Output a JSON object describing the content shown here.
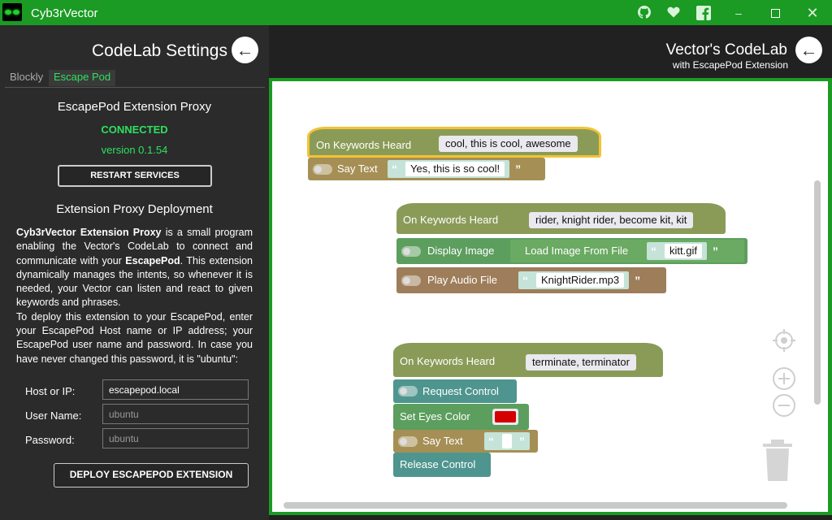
{
  "window": {
    "title": "Cyb3rVector",
    "icons": [
      "github-icon",
      "heart-icon",
      "facebook-icon",
      "minimize-icon",
      "maximize-icon",
      "close-icon"
    ]
  },
  "settings": {
    "title": "CodeLab Settings",
    "tabs": [
      {
        "label": "Blockly",
        "active": false
      },
      {
        "label": "Escape Pod",
        "active": true
      }
    ],
    "proxy_title": "EscapePod Extension Proxy",
    "status": "CONNECTED",
    "version": "version 0.1.54",
    "restart_label": "RESTART SERVICES",
    "deploy_title": "Extension Proxy Deployment",
    "description": {
      "p1_bold": "Cyb3rVector Extension Proxy",
      "p1_a": " is a small program enabling the Vector's CodeLab to connect and communicate with your ",
      "p1_bold2": "EscapePod",
      "p1_b": ". This extension dynamically manages the intents, so whenever it is needed, your Vector can listen and react to given keywords and phrases.",
      "p2": "To deploy this extension to your EscapePod, enter your EscapePod Host name or IP address; your EscapePod user name and password. In case you have never changed this password, it is \"ubuntu\":"
    },
    "form": {
      "host_label": "Host or IP:",
      "host_value": "escapepod.local",
      "user_label": "User Name:",
      "user_placeholder": "ubuntu",
      "pass_label": "Password:",
      "pass_placeholder": "ubuntu"
    },
    "deploy_label": "DEPLOY ESCAPEPOD EXTENSION"
  },
  "codelab": {
    "title": "Vector's CodeLab",
    "subtitle": "with EscapePod Extension",
    "blocks": {
      "g1": {
        "hat": "On Keywords Heard",
        "keywords": "cool, this is cool, awesome",
        "say_label": "Say Text",
        "say_text": "Yes, this is so cool!"
      },
      "g2": {
        "hat": "On Keywords Heard",
        "keywords": "rider, knight rider, become kit, kit",
        "display_label": "Display Image",
        "load_label": "Load Image From File",
        "image_file": "kitt.gif",
        "audio_label": "Play Audio File",
        "audio_file": "KnightRider.mp3"
      },
      "g3": {
        "hat": "On Keywords Heard",
        "keywords": "terminate, terminator",
        "request_label": "Request Control",
        "eyes_label": "Set Eyes Color",
        "eye_color": "#d40000",
        "say_label": "Say Text",
        "say_text": "",
        "release_label": "Release Control"
      }
    },
    "colors": {
      "trigger": "#8a9b58",
      "speech": "#a58f55",
      "display": "#5c9e5e",
      "audio": "#9e7d5a",
      "control": "#4f958f",
      "accent": "#1b9a24"
    }
  }
}
